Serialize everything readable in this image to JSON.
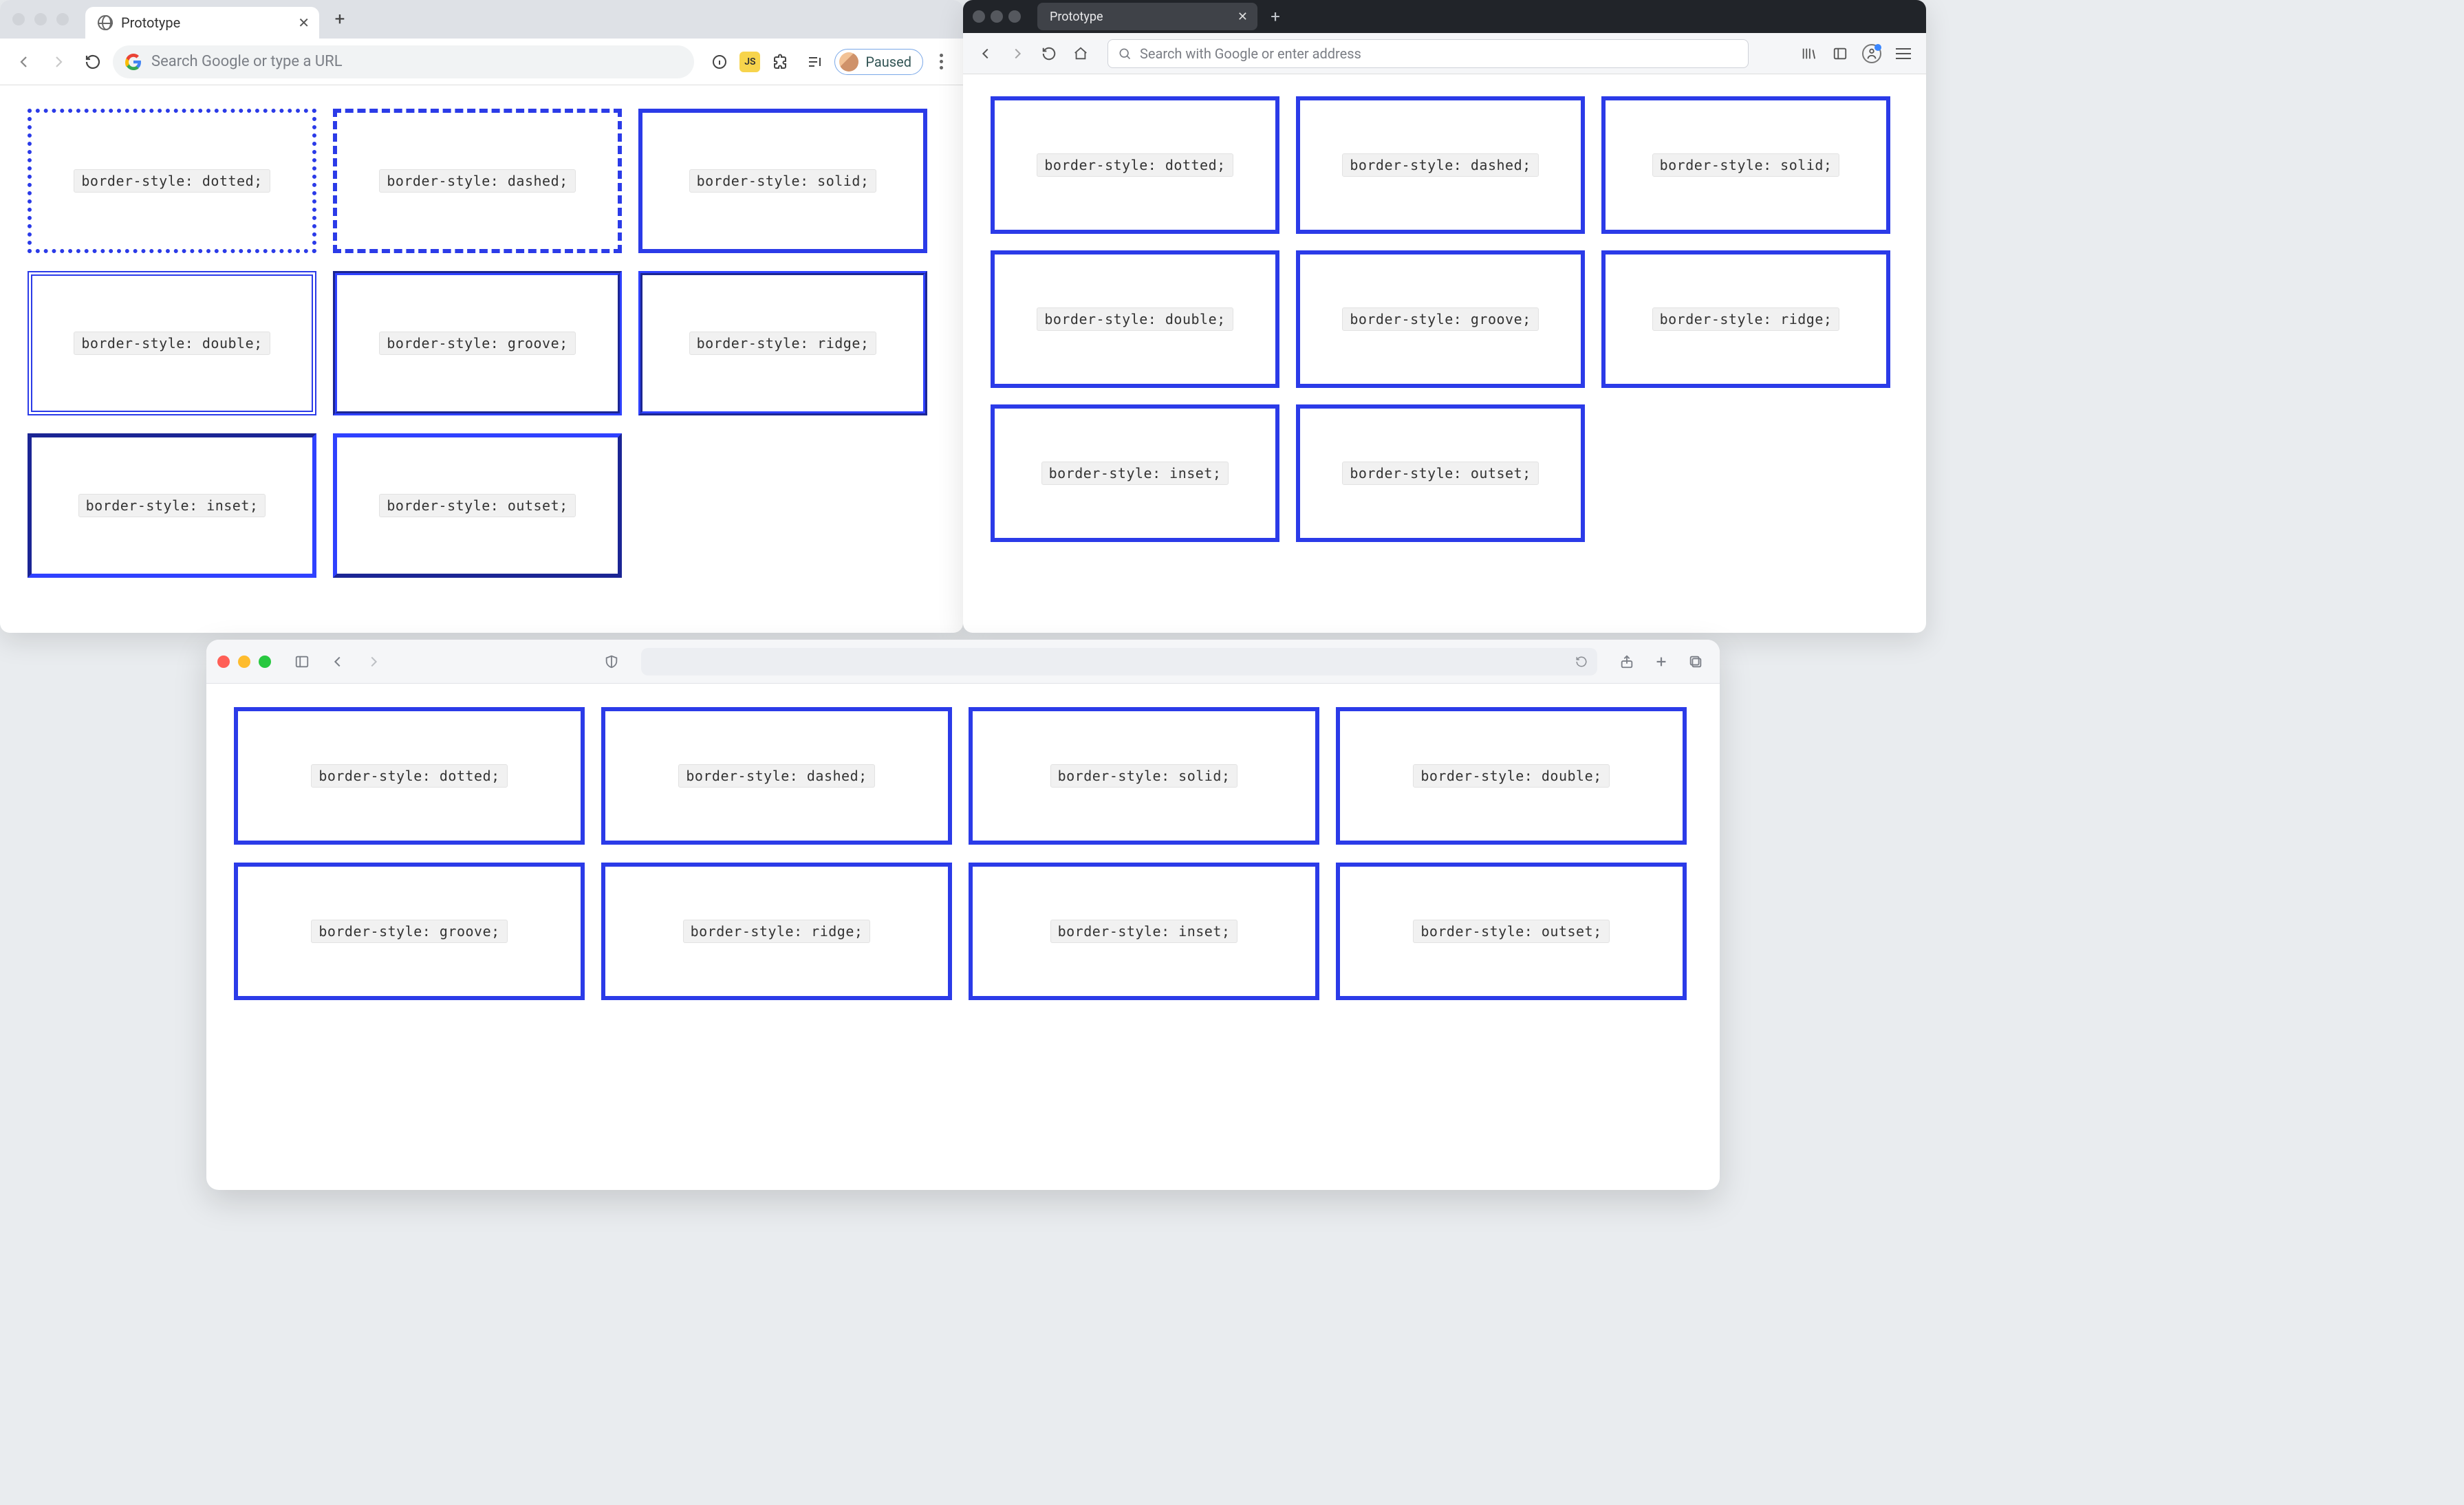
{
  "chrome": {
    "tab_title": "Prototype",
    "omnibox_placeholder": "Search Google or type a URL",
    "profile_label": "Paused"
  },
  "firefox": {
    "tab_title": "Prototype",
    "urlbar_placeholder": "Search with Google or enter address"
  },
  "safari": {
    "urlbar_placeholder": ""
  },
  "border_styles": {
    "dotted": "border-style: dotted;",
    "dashed": "border-style: dashed;",
    "solid": "border-style: solid;",
    "double": "border-style: double;",
    "groove": "border-style: groove;",
    "ridge": "border-style: ridge;",
    "inset": "border-style: inset;",
    "outset": "border-style: outset;"
  },
  "colors": {
    "border_blue": "#2b3be8"
  }
}
